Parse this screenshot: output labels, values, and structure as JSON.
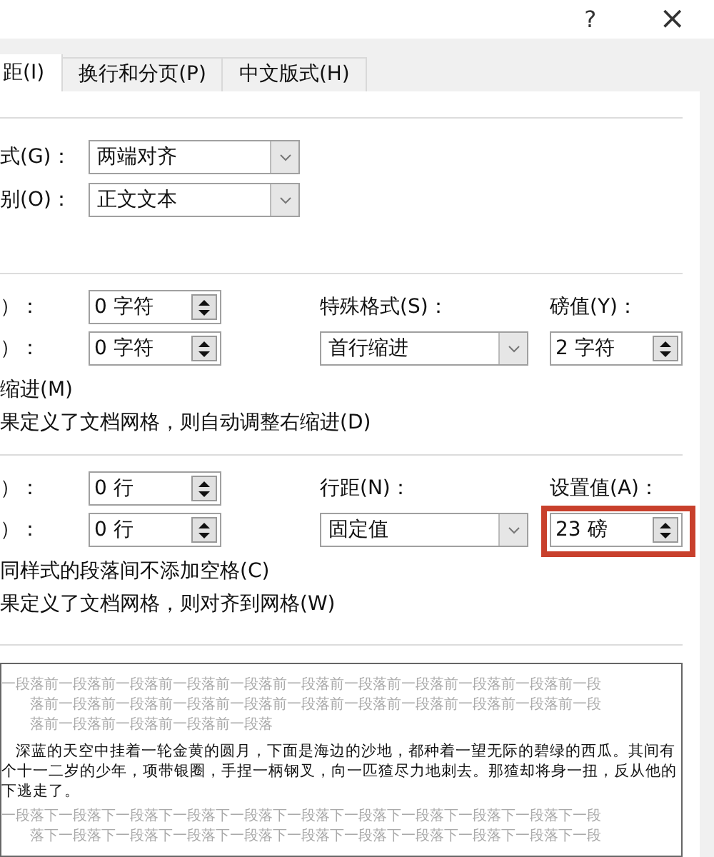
{
  "title_bar": {
    "help": "?",
    "close": "×"
  },
  "tabs": [
    {
      "label": "距(I)",
      "selected": true
    },
    {
      "label": "换行和分页(P)",
      "selected": false
    },
    {
      "label": "中文版式(H)",
      "selected": false
    }
  ],
  "general": [
    {
      "label": "式(G)：",
      "value": "两端对齐"
    },
    {
      "label": "别(O)：",
      "value": "正文文本"
    }
  ],
  "indent": {
    "rows": [
      {
        "label": "）：",
        "value": "0 字符"
      },
      {
        "label": "）：",
        "value": "0 字符"
      }
    ],
    "special_label": "特殊格式(S)：",
    "special_value": "首行缩进",
    "by_label": "磅值(Y)：",
    "by_value": "2 字符",
    "options": [
      "缩进(M)",
      "果定义了文档网格，则自动调整右缩进(D)"
    ]
  },
  "spacing": {
    "rows": [
      {
        "label": "）：",
        "value": "0 行"
      },
      {
        "label": "）：",
        "value": "0 行"
      }
    ],
    "special_label": "行距(N)：",
    "special_value": "固定值",
    "by_label": "设置值(A)：",
    "by_value": "23 磅",
    "by_highlighted": true,
    "options": [
      "同样式的段落间不添加空格(C)",
      "果定义了文档网格，则对齐到网格(W)"
    ]
  },
  "preview": [
    {
      "kind": "sample",
      "text": "一段落前一段落前一段落前一段落前一段落前一段落前一段落前一段落前一段落前一段落前一段"
    },
    {
      "kind": "sample",
      "text": "落前一段落前一段落前一段落前一段落前一段落前一段落前一段落前一段落前一段落前一段"
    },
    {
      "kind": "sample",
      "text": "落前一段落前一段落前一段落前一段落"
    },
    {
      "kind": "body",
      "text": "深蓝的天空中挂着一轮金黄的圆月，下面是海边的沙地，都种着一望无际的碧绿的西瓜。其间有"
    },
    {
      "kind": "body",
      "text": "个十一二岁的少年，项带银圈，手捏一柄钢叉，向一匹猹尽力地刺去。那猹却将身一扭，反从他的"
    },
    {
      "kind": "body",
      "text": "下逃走了。"
    },
    {
      "kind": "sample",
      "text": "一段落下一段落下一段落下一段落下一段落下一段落下一段落下一段落下一段落下一段落下一段"
    },
    {
      "kind": "sample",
      "text": "落下一段落下一段落下一段落下一段落下一段落下一段落下一段落下一段落下一段落下一段"
    }
  ]
}
